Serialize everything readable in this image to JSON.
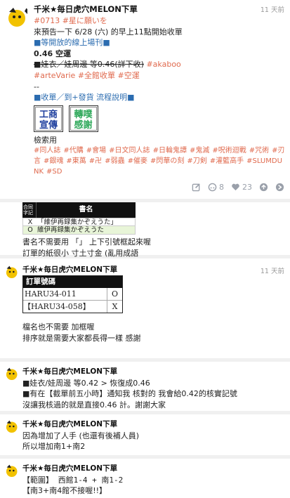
{
  "post": {
    "author": "千米★毎日虎穴MELON下單",
    "time": "11 天前",
    "lines": {
      "tags1a": "#0713",
      "tags1b": "#星に願いを",
      "l2": "來預告一下 6/28 (六) 的早上11點開始收單",
      "l3": "■等開放的線上場刊■",
      "l4": "0.46 空運",
      "l5": "■娃衣／娃周邊 等0.46(詳下收)",
      "l5tag": "#akaboo",
      "l6a": "#arteVarie",
      "l6b": "#全館收單",
      "l6c": "#空運",
      "l7": "--",
      "l8": "■收單／到+發貨 流程說明■",
      "stamp1": "工商宣傳",
      "stamp2": "轉噗感謝",
      "l9": "檢索用"
    },
    "search_tags": [
      "#同人誌",
      "#代購",
      "#會場",
      "#日文同人誌",
      "#日輪鬼譚",
      "#鬼滅",
      "#呪術迴戰",
      "#咒術",
      "#刃言",
      "#銀魂",
      "#東萬",
      "#卍",
      "#弱蟲",
      "#催麥",
      "#閃華の刻",
      "#刀剣",
      "#灌籃高手",
      "#SLUMDUNK",
      "#SD"
    ],
    "counts": {
      "comments": "8",
      "likes": "23"
    }
  },
  "reply1": {
    "table_header_left": "合同\n字記",
    "table_header": "書名",
    "row1_mark": "X",
    "row1": "「維伊再録集かぞえうた」",
    "row2_mark": "O",
    "row2": "維伊再録集かぞえうた",
    "text1": "書名不需要用 「」 上下引號框起來喔",
    "text2": "訂單的紙很小 寸土寸金 (亂用成語"
  },
  "reply2": {
    "author": "千米★毎日虎穴MELON下單",
    "time": "11 天前",
    "table_header": "訂單號碼",
    "row1": "HARU34-011",
    "row1_mark": "O",
    "row2": "【HARU34-058】",
    "row2_mark": "X",
    "text1": "檔名也不需要 加框喔",
    "text2": "排序就是需要大家都長得一樣 感謝"
  },
  "reply3": {
    "author": "千米★毎日虎穴MELON下單",
    "text1": "■娃衣/娃周邊 等0.42 > 恢復成0.46",
    "text2": "■有在【截單前五小時】通知我 核對的 我會給0.42的核實記號",
    "text3": "沒讓我核過的就是直接0.46 計。謝謝大家"
  },
  "reply4": {
    "author": "千米★毎日虎穴MELON下單",
    "text1": "因為增加了人手 (也還有後補人員)",
    "text2": "所以增加南1+南2"
  },
  "reply5": {
    "author": "千米★毎日虎穴MELON下單",
    "text1": "【範圍】 西館1-4 + 南1-2",
    "text2": "【南3+南4館不接喔!!】"
  },
  "colors": {
    "tag": "#e06a4e",
    "link": "#2b6cb0"
  },
  "icons": [
    "edit-icon",
    "comment-icon",
    "heart-icon",
    "replurk-icon",
    "share-icon"
  ]
}
